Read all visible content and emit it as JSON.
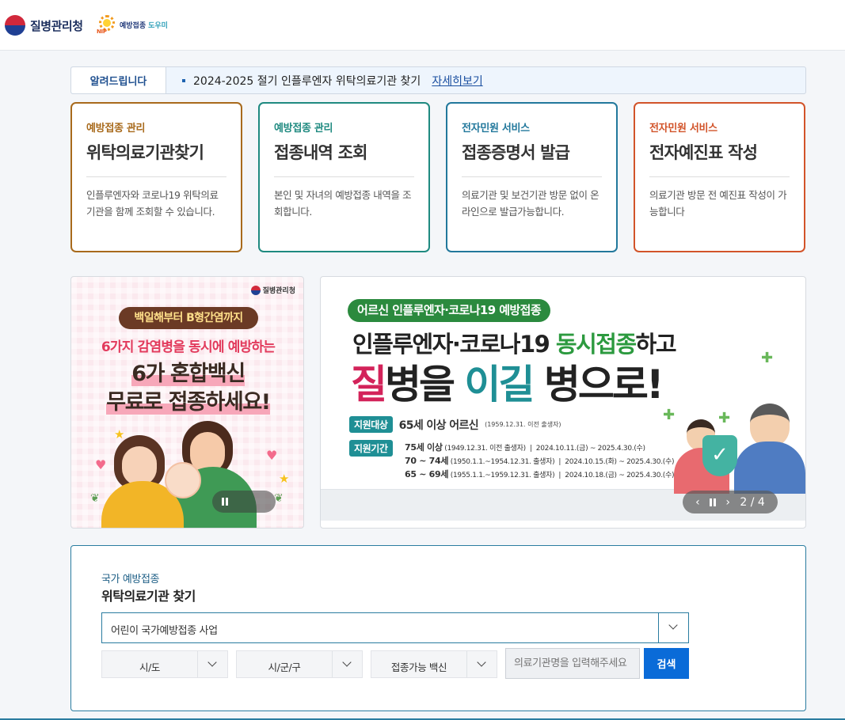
{
  "header": {
    "org_name": "질병관리청",
    "helper_logo_a": "예방접종",
    "helper_logo_b": "도우미",
    "helper_logo_mark": "NIP"
  },
  "notice": {
    "tag": "알려드립니다",
    "text": "2024-2025 절기 인플루엔자 위탁의료기관 찾기",
    "link": "자세히보기"
  },
  "cards": [
    {
      "category": "예방접종 관리",
      "title": "위탁의료기관찾기",
      "desc": "인플루엔자와 코로나19 위탁의료기관을 함께 조회할 수 있습니다.",
      "color": "#a86a1c"
    },
    {
      "category": "예방접종 관리",
      "title": "접종내역 조회",
      "desc": "본인 및 자녀의 예방접종 내역을 조회합니다.",
      "color": "#1f8a80"
    },
    {
      "category": "전자민원 서비스",
      "title": "접종증명서 발급",
      "desc": "의료기관 및 보건기관 방문 없이 온라인으로 발급가능합니다.",
      "color": "#22789c"
    },
    {
      "category": "전자민원 서비스",
      "title": "전자예진표 작성",
      "desc": "의료기관 방문 전 예진표 작성이 가능합니다",
      "color": "#d2542a"
    }
  ],
  "banner_left": {
    "logo": "질병관리청",
    "pill": "백일해부터 B형간염까지",
    "line1": "6가지 감염병을 동시에 예방하는",
    "line2": "6가 혼합백신",
    "line3": "무료로 접종하세요!"
  },
  "banner_right": {
    "tag": "어르신 인플루엔자·코로나19 예방접종",
    "line1_a": "인플루엔자·코로나19 ",
    "line1_b": "동시접종",
    "line1_c": "하고",
    "line2_a": "질",
    "line2_b": "병을 ",
    "line2_c": "이길",
    "line2_d": " 병으로!",
    "target_badge": "지원대상",
    "target_main": "65세 이상 어르신",
    "target_note": "(1959.12.31. 이전 출생자)",
    "period_badge": "지원기간",
    "periods": [
      {
        "age": "75세 이상",
        "born": "(1949.12.31. 이전 출생자)",
        "range": "2024.10.11.(금) ~ 2025.4.30.(수)"
      },
      {
        "age": "70 ~ 74세",
        "born": "(1950.1.1.~1954.12.31. 출생자)",
        "range": "2024.10.15.(화) ~ 2025.4.30.(수)"
      },
      {
        "age": "65 ~ 69세",
        "born": "(1955.1.1.~1959.12.31. 출생자)",
        "range": "2024.10.18.(금) ~ 2025.4.30.(수)"
      }
    ],
    "prev": "‹",
    "next": "›",
    "counter": "2 / 4"
  },
  "search": {
    "category": "국가 예방접종",
    "title": "위탁의료기관 찾기",
    "program": "어린이 국가예방접종 사업",
    "sido": "시/도",
    "sigungu": "시/군/구",
    "vaccine": "접종가능 백신",
    "placeholder": "의료기관명을 입력해주세요",
    "button": "검색"
  }
}
